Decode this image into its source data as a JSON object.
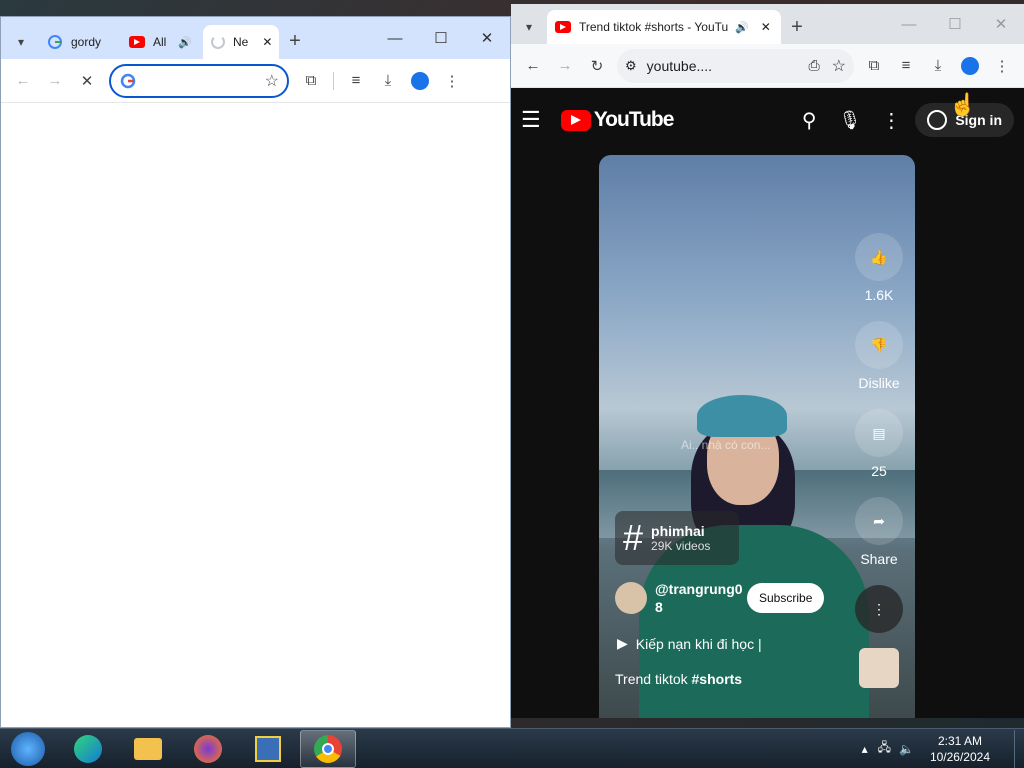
{
  "left_window": {
    "tabs": [
      {
        "label": "gordy",
        "icon": "google-g-icon"
      },
      {
        "label": "All",
        "icon": "youtube-icon"
      },
      {
        "label": "Ne",
        "icon": "loading-icon"
      }
    ],
    "new_tab": "+",
    "controls": {
      "minimize": "—",
      "maximize": "☐",
      "close": "✕"
    },
    "toolbar": {
      "back": "←",
      "forward": "→",
      "stop": "✕",
      "omnibox_value": ""
    }
  },
  "right_window": {
    "tab_title": "Trend tiktok #shorts - YouTu",
    "new_tab": "+",
    "controls": {
      "minimize": "—",
      "maximize": "☐",
      "close": "✕"
    },
    "url": "youtube....",
    "youtube": {
      "logo_text": "YouTube",
      "sign_in": "Sign in",
      "likes": "1.6K",
      "dislike_label": "Dislike",
      "comments": "25",
      "share_label": "Share",
      "hashtag_name": "phimhai",
      "hashtag_videos": "29K videos",
      "channel_handle_line1": "@trangrung0",
      "channel_handle_line2": "8",
      "subscribe": "Subscribe",
      "playlist_title": "Kiếp nạn khi đi học |",
      "video_title_plain": "Trend tiktok ",
      "video_title_tag": "#shorts",
      "watermark": "Ai.. nhà có con..."
    }
  },
  "taskbar": {
    "time": "2:31 AM",
    "date": "10/26/2024",
    "items": [
      "start-orb",
      "edge",
      "file-explorer",
      "firefox",
      "app",
      "chrome"
    ]
  },
  "colors": {
    "accent": "#0b57d0",
    "youtube_red": "#ff0000",
    "chrome_tab_bg": "#d3e3fd"
  }
}
